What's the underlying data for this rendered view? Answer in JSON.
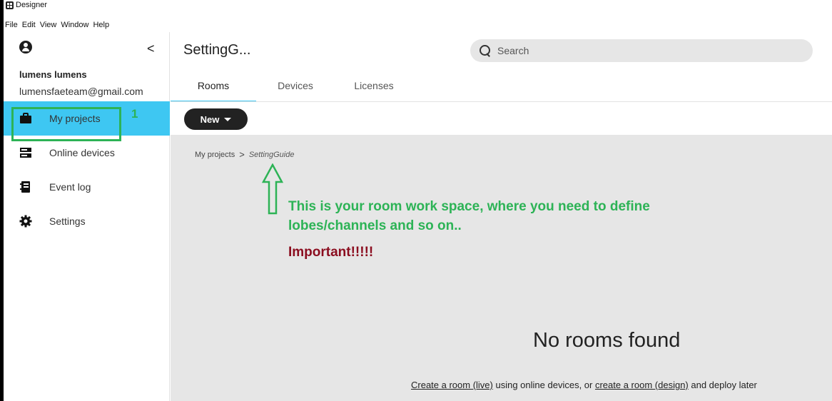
{
  "window": {
    "title": "Designer"
  },
  "menu": [
    "File",
    "Edit",
    "View",
    "Window",
    "Help"
  ],
  "sidebar": {
    "user_name": "lumens lumens",
    "user_email": "lumensfaeteam@gmail.com",
    "collapse": "<",
    "items": [
      {
        "label": "My projects",
        "icon": "briefcase-icon",
        "active": true
      },
      {
        "label": "Online devices",
        "icon": "server-icon",
        "active": false
      },
      {
        "label": "Event log",
        "icon": "book-icon",
        "active": false
      },
      {
        "label": "Settings",
        "icon": "gear-icon",
        "active": false
      }
    ]
  },
  "annotations": {
    "step_number": "1",
    "line1": "This is your room work space, where you need to define",
    "line2": "lobes/channels and so on..",
    "important": "Important!!!!!",
    "color_green": "#2db356",
    "color_red": "#8b0d1f"
  },
  "header": {
    "title": "SettingG...",
    "search_placeholder": "Search"
  },
  "tabs": [
    {
      "label": "Rooms",
      "active": true
    },
    {
      "label": "Devices",
      "active": false
    },
    {
      "label": "Licenses",
      "active": false
    }
  ],
  "toolbar": {
    "new_label": "New"
  },
  "breadcrumb": {
    "root": "My projects",
    "sep": ">",
    "current": "SettingGuide"
  },
  "empty_state": {
    "title": "No rooms found",
    "link_live": "Create a room (live)",
    "text_mid": " using online devices, or ",
    "link_design": "create a room (design)",
    "text_end": " and deploy later"
  },
  "colors": {
    "accent": "#3ec7f2",
    "dark_button": "#222222",
    "workspace_bg": "#e6e6e6"
  }
}
